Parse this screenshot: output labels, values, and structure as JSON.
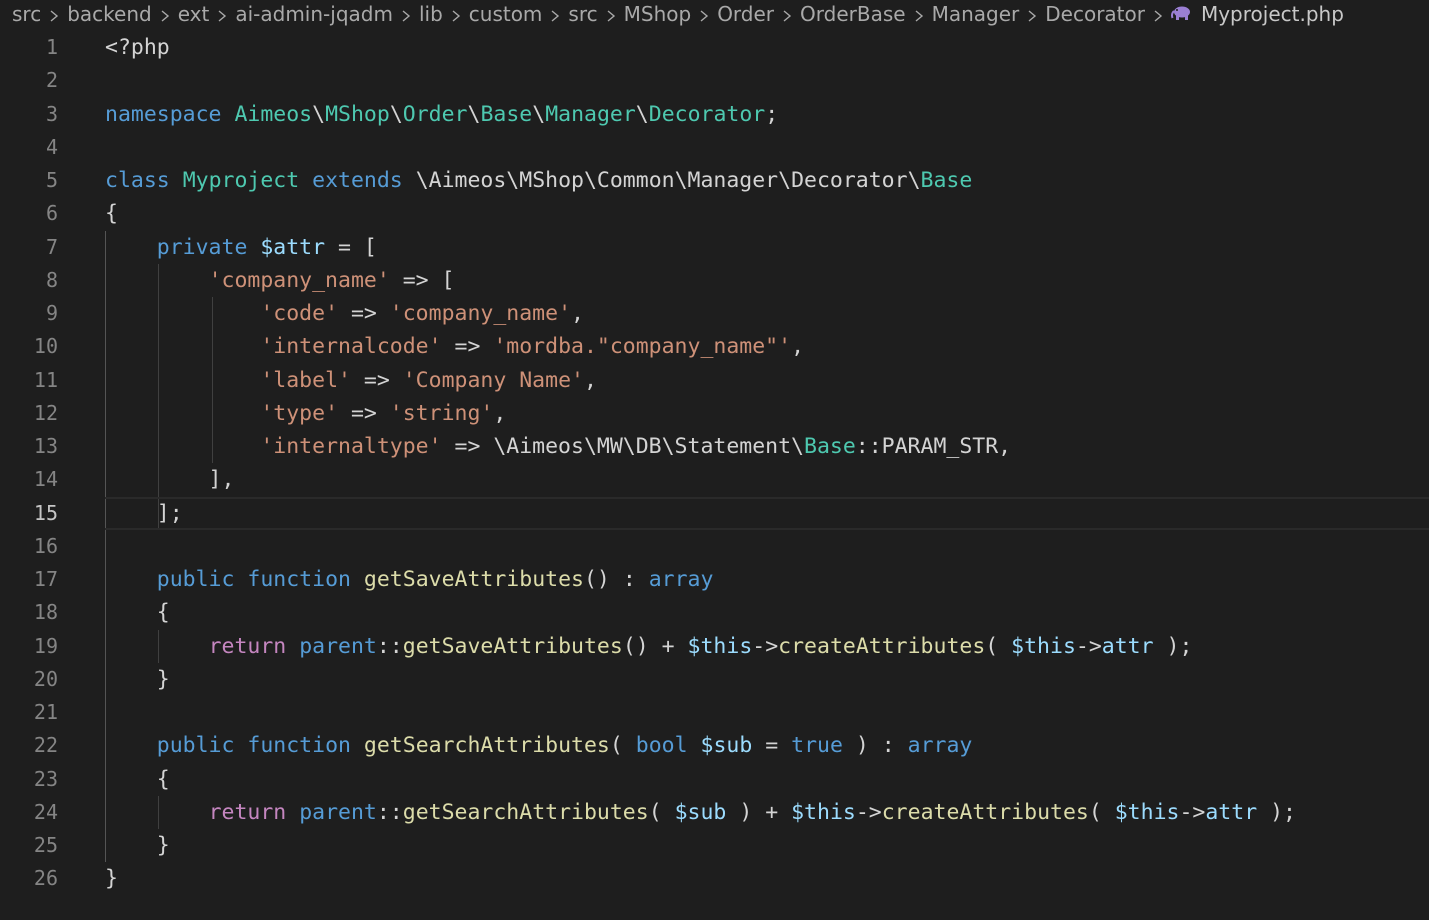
{
  "breadcrumb": {
    "items": [
      "src",
      "backend",
      "ext",
      "ai-admin-jqadm",
      "lib",
      "custom",
      "src",
      "MShop",
      "Order",
      "OrderBase",
      "Manager",
      "Decorator"
    ],
    "file": "Myproject.php",
    "file_icon": "php-elephant-icon",
    "file_icon_color": "#9b7fd4"
  },
  "editor": {
    "current_line": 15,
    "lines": [
      {
        "n": "1",
        "tokens": [
          [
            "punc",
            "<?php"
          ]
        ]
      },
      {
        "n": "2",
        "tokens": []
      },
      {
        "n": "3",
        "tokens": [
          [
            "kw",
            "namespace"
          ],
          [
            "punc",
            " "
          ],
          [
            "ns",
            "Aimeos"
          ],
          [
            "punc",
            "\\"
          ],
          [
            "ns",
            "MShop"
          ],
          [
            "punc",
            "\\"
          ],
          [
            "ns",
            "Order"
          ],
          [
            "punc",
            "\\"
          ],
          [
            "ns",
            "Base"
          ],
          [
            "punc",
            "\\"
          ],
          [
            "ns",
            "Manager"
          ],
          [
            "punc",
            "\\"
          ],
          [
            "ns",
            "Decorator"
          ],
          [
            "punc",
            ";"
          ]
        ]
      },
      {
        "n": "4",
        "tokens": []
      },
      {
        "n": "5",
        "tokens": [
          [
            "kw",
            "class"
          ],
          [
            "punc",
            " "
          ],
          [
            "cls",
            "Myproject"
          ],
          [
            "punc",
            " "
          ],
          [
            "kw",
            "extends"
          ],
          [
            "punc",
            " \\Aimeos\\MShop\\Common\\Manager\\Decorator\\"
          ],
          [
            "cls",
            "Base"
          ]
        ]
      },
      {
        "n": "6",
        "tokens": [
          [
            "punc",
            "{"
          ]
        ]
      },
      {
        "n": "7",
        "tokens": [
          [
            "punc",
            "    "
          ],
          [
            "kw",
            "private"
          ],
          [
            "punc",
            " "
          ],
          [
            "var",
            "$attr"
          ],
          [
            "punc",
            " = ["
          ]
        ]
      },
      {
        "n": "8",
        "tokens": [
          [
            "punc",
            "        "
          ],
          [
            "str",
            "'company_name'"
          ],
          [
            "punc",
            " => ["
          ]
        ]
      },
      {
        "n": "9",
        "tokens": [
          [
            "punc",
            "            "
          ],
          [
            "str",
            "'code'"
          ],
          [
            "punc",
            " => "
          ],
          [
            "str",
            "'company_name'"
          ],
          [
            "punc",
            ","
          ]
        ]
      },
      {
        "n": "10",
        "tokens": [
          [
            "punc",
            "            "
          ],
          [
            "str",
            "'internalcode'"
          ],
          [
            "punc",
            " => "
          ],
          [
            "str",
            "'mordba.\"company_name\"'"
          ],
          [
            "punc",
            ","
          ]
        ]
      },
      {
        "n": "11",
        "tokens": [
          [
            "punc",
            "            "
          ],
          [
            "str",
            "'label'"
          ],
          [
            "punc",
            " => "
          ],
          [
            "str",
            "'Company Name'"
          ],
          [
            "punc",
            ","
          ]
        ]
      },
      {
        "n": "12",
        "tokens": [
          [
            "punc",
            "            "
          ],
          [
            "str",
            "'type'"
          ],
          [
            "punc",
            " => "
          ],
          [
            "str",
            "'string'"
          ],
          [
            "punc",
            ","
          ]
        ]
      },
      {
        "n": "13",
        "tokens": [
          [
            "punc",
            "            "
          ],
          [
            "str",
            "'internaltype'"
          ],
          [
            "punc",
            " => \\Aimeos\\MW\\DB\\Statement\\"
          ],
          [
            "cls",
            "Base"
          ],
          [
            "punc",
            "::PARAM_STR,"
          ]
        ]
      },
      {
        "n": "14",
        "tokens": [
          [
            "punc",
            "        ],"
          ]
        ]
      },
      {
        "n": "15",
        "tokens": [
          [
            "punc",
            "    ];"
          ]
        ]
      },
      {
        "n": "16",
        "tokens": []
      },
      {
        "n": "17",
        "tokens": [
          [
            "punc",
            "    "
          ],
          [
            "kw",
            "public"
          ],
          [
            "punc",
            " "
          ],
          [
            "kw",
            "function"
          ],
          [
            "punc",
            " "
          ],
          [
            "fn",
            "getSaveAttributes"
          ],
          [
            "punc",
            "() : "
          ],
          [
            "kw",
            "array"
          ]
        ]
      },
      {
        "n": "18",
        "tokens": [
          [
            "punc",
            "    {"
          ]
        ]
      },
      {
        "n": "19",
        "tokens": [
          [
            "punc",
            "        "
          ],
          [
            "kw2",
            "return"
          ],
          [
            "punc",
            " "
          ],
          [
            "kw",
            "parent"
          ],
          [
            "punc",
            "::"
          ],
          [
            "fn",
            "getSaveAttributes"
          ],
          [
            "punc",
            "() + "
          ],
          [
            "var",
            "$this"
          ],
          [
            "punc",
            "->"
          ],
          [
            "fn",
            "createAttributes"
          ],
          [
            "punc",
            "( "
          ],
          [
            "var",
            "$this"
          ],
          [
            "punc",
            "->"
          ],
          [
            "var",
            "attr"
          ],
          [
            "punc",
            " );"
          ]
        ]
      },
      {
        "n": "20",
        "tokens": [
          [
            "punc",
            "    }"
          ]
        ]
      },
      {
        "n": "21",
        "tokens": []
      },
      {
        "n": "22",
        "tokens": [
          [
            "punc",
            "    "
          ],
          [
            "kw",
            "public"
          ],
          [
            "punc",
            " "
          ],
          [
            "kw",
            "function"
          ],
          [
            "punc",
            " "
          ],
          [
            "fn",
            "getSearchAttributes"
          ],
          [
            "punc",
            "( "
          ],
          [
            "kw",
            "bool"
          ],
          [
            "punc",
            " "
          ],
          [
            "var",
            "$sub"
          ],
          [
            "punc",
            " = "
          ],
          [
            "kw",
            "true"
          ],
          [
            "punc",
            " ) : "
          ],
          [
            "kw",
            "array"
          ]
        ]
      },
      {
        "n": "23",
        "tokens": [
          [
            "punc",
            "    {"
          ]
        ]
      },
      {
        "n": "24",
        "tokens": [
          [
            "punc",
            "        "
          ],
          [
            "kw2",
            "return"
          ],
          [
            "punc",
            " "
          ],
          [
            "kw",
            "parent"
          ],
          [
            "punc",
            "::"
          ],
          [
            "fn",
            "getSearchAttributes"
          ],
          [
            "punc",
            "( "
          ],
          [
            "var",
            "$sub"
          ],
          [
            "punc",
            " ) + "
          ],
          [
            "var",
            "$this"
          ],
          [
            "punc",
            "->"
          ],
          [
            "fn",
            "createAttributes"
          ],
          [
            "punc",
            "( "
          ],
          [
            "var",
            "$this"
          ],
          [
            "punc",
            "->"
          ],
          [
            "var",
            "attr"
          ],
          [
            "punc",
            " );"
          ]
        ]
      },
      {
        "n": "25",
        "tokens": [
          [
            "punc",
            "    }"
          ]
        ]
      },
      {
        "n": "26",
        "tokens": [
          [
            "punc",
            "}"
          ]
        ]
      }
    ]
  }
}
